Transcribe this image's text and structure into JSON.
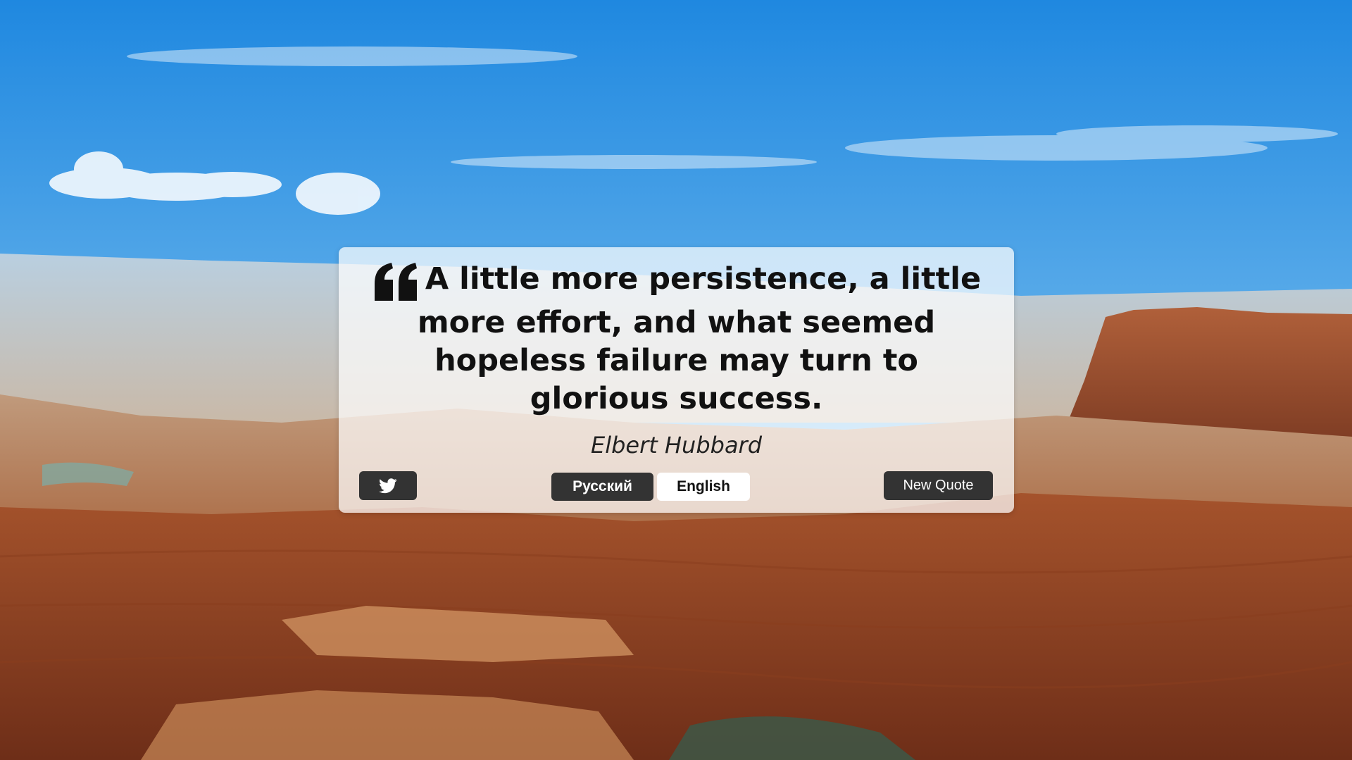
{
  "quote": {
    "text": "A little more persistence, a little more effort, and what seemed hopeless failure may turn to glorious success.",
    "author": "Elbert Hubbard"
  },
  "buttons": {
    "twitter_icon": "twitter-icon",
    "russian_label": "Русский",
    "english_label": "English",
    "new_quote_label": "New Quote"
  },
  "colors": {
    "button_dark": "#333333",
    "active_language": "#ffffff",
    "card_background": "rgba(255,255,255,0.72)"
  }
}
